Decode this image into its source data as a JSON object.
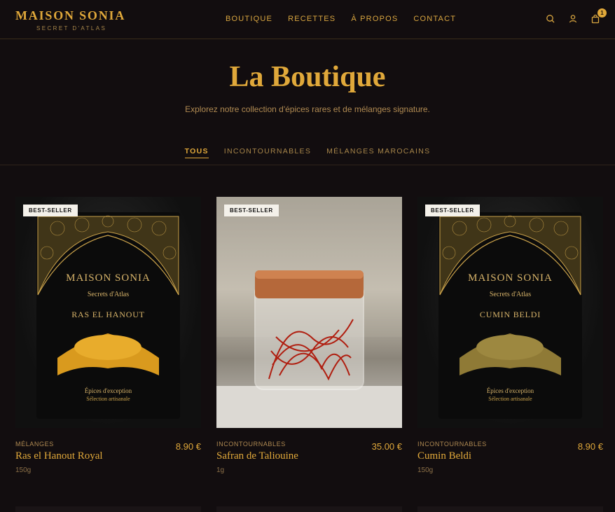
{
  "brand": {
    "name": "MAISON SONIA",
    "tagline": "SECRET D'ATLAS"
  },
  "nav": [
    "BOUTIQUE",
    "RECETTES",
    "À PROPOS",
    "CONTACT"
  ],
  "header_icons": {
    "search": "search-icon",
    "account": "user-icon",
    "cart": "shopping-bag-icon",
    "cart_count": "1"
  },
  "hero": {
    "title": "La Boutique",
    "subtitle": "Explorez notre collection d'épices rares et de mélanges signature."
  },
  "filters": [
    {
      "label": "TOUS",
      "active": true
    },
    {
      "label": "INCONTOURNABLES",
      "active": false
    },
    {
      "label": "MÉLANGES MAROCAINS",
      "active": false
    }
  ],
  "products": [
    {
      "badge": "BEST-SELLER",
      "category": "MÉLANGES",
      "name": "Ras el Hanout Royal",
      "weight": "150g",
      "price": "8.90 €",
      "pack": {
        "brand": "MAISON SONIA",
        "line": "Secrets d'Atlas",
        "product": "RAS EL HANOUT",
        "foot1": "Épices d'exception",
        "foot2": "Sélection artisanale",
        "spice_color": "#d99a1e"
      }
    },
    {
      "badge": "BEST-SELLER",
      "category": "INCONTOURNABLES",
      "name": "Safran de Taliouine",
      "weight": "1g",
      "price": "35.00 €"
    },
    {
      "badge": "BEST-SELLER",
      "category": "INCONTOURNABLES",
      "name": "Cumin Beldi",
      "weight": "150g",
      "price": "8.90 €",
      "pack": {
        "brand": "MAISON SONIA",
        "line": "Secrets d'Atlas",
        "product": "CUMIN BELDI",
        "foot1": "Épices d'exception",
        "foot2": "Sélection artisanale",
        "spice_color": "#8f7a36"
      }
    }
  ],
  "colors": {
    "background": "#120d0f",
    "accent": "#e0a83a",
    "muted": "#b08a52"
  }
}
